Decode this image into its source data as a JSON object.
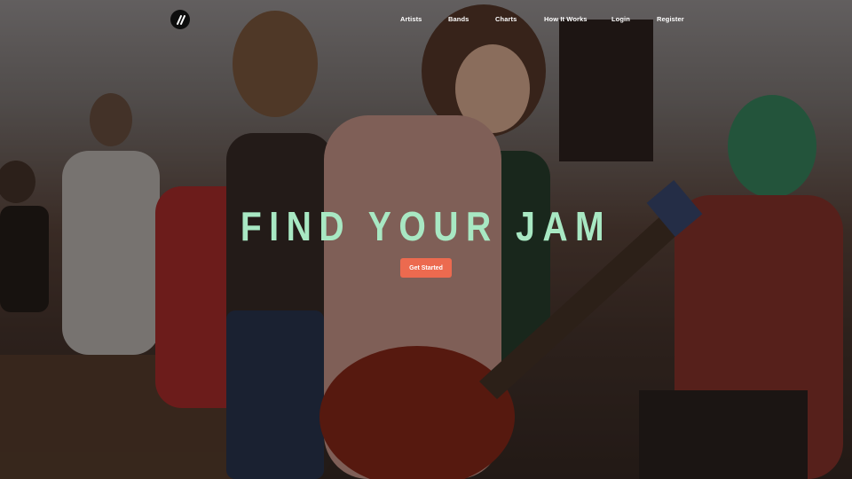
{
  "nav": {
    "logo_icon": "pencil-slash-logo-icon",
    "links": [
      "Artists",
      "Bands",
      "Charts",
      "How It Works",
      "Login",
      "Register"
    ]
  },
  "hero": {
    "headline": "FIND YOUR JAM",
    "cta_label": "Get Started",
    "background_image": "musicians-outdoor-guitar-photo"
  },
  "colors": {
    "headline": "#a8e8c3",
    "cta": "#ec6a4f",
    "nav_text": "#ffffff",
    "logo_bg": "#0d0d0d"
  }
}
